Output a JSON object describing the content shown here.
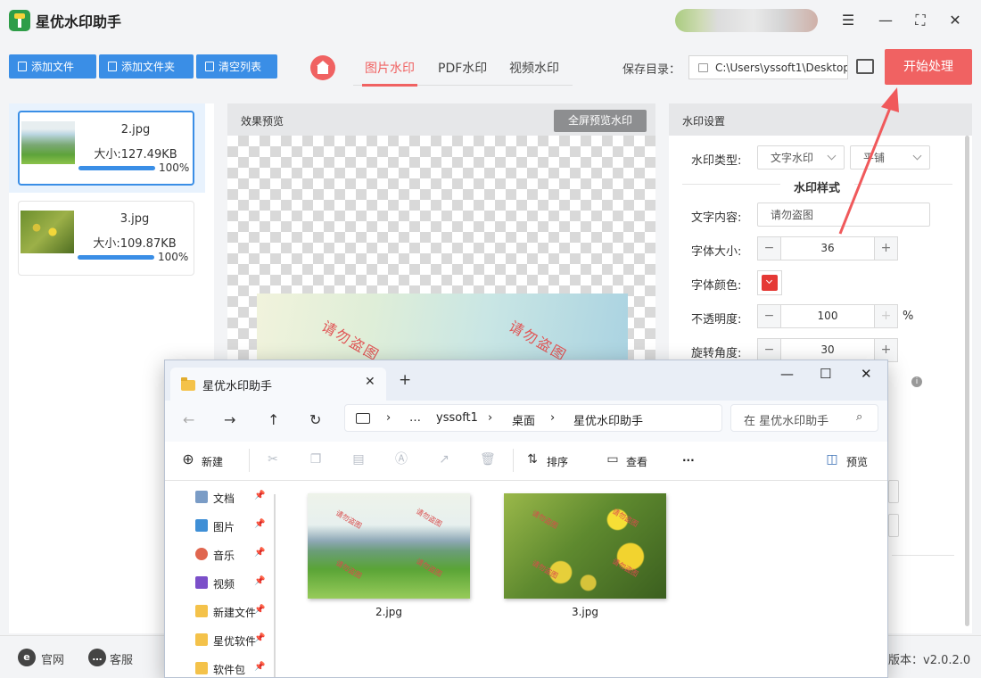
{
  "app": {
    "title": "星优水印助手",
    "colors": {
      "accent": "#3a8ee6",
      "brand_red": "#f06262"
    }
  },
  "toolbar": {
    "add_file": "添加文件",
    "add_folder": "添加文件夹",
    "clear_list": "清空列表"
  },
  "tabs": [
    "图片水印",
    "PDF水印",
    "视频水印"
  ],
  "save": {
    "label": "保存目录：",
    "path": "C:\\Users\\yssoft1\\Desktop"
  },
  "start_button": "开始处理",
  "files": [
    {
      "name": "2.jpg",
      "size": "大小:127.49KB",
      "progress": "100%"
    },
    {
      "name": "3.jpg",
      "size": "大小:109.87KB",
      "progress": "100%"
    }
  ],
  "preview": {
    "title": "效果预览",
    "fullscreen_button": "全屏预览水印",
    "watermark_text": "请勿盗图"
  },
  "settings": {
    "title": "水印设置",
    "type_label": "水印类型:",
    "type_value": "文字水印",
    "layout_value": "平铺",
    "style_title": "水印样式",
    "text_label": "文字内容:",
    "text_value": "请勿盗图",
    "font_size_label": "字体大小:",
    "font_size_value": "36",
    "color_label": "字体颜色:",
    "color_value": "#e53935",
    "opacity_label": "不透明度:",
    "opacity_value": "100",
    "opacity_unit": "%",
    "rotation_label": "旋转角度:",
    "rotation_value": "30",
    "stepper_minus": "−",
    "stepper_plus": "+"
  },
  "statusbar": {
    "website": "官网",
    "support": "客服",
    "version": "版本：v2.0.2.0"
  },
  "explorer": {
    "tab_title": "星优水印助手",
    "breadcrumb": [
      "…",
      "yssoft1",
      "桌面",
      "星优水印助手"
    ],
    "search_placeholder": "在 星优水印助手",
    "commands": {
      "new": "新建",
      "sort": "排序",
      "view": "查看",
      "more": "···",
      "preview": "预览"
    },
    "sidebar": [
      {
        "label": "文档",
        "icon": "document-icon"
      },
      {
        "label": "图片",
        "icon": "pictures-icon"
      },
      {
        "label": "音乐",
        "icon": "music-icon"
      },
      {
        "label": "视频",
        "icon": "video-icon"
      },
      {
        "label": "新建文件",
        "icon": "folder-icon"
      },
      {
        "label": "星优软件",
        "icon": "folder-icon"
      },
      {
        "label": "软件包",
        "icon": "folder-icon"
      }
    ],
    "files": [
      {
        "name": "2.jpg"
      },
      {
        "name": "3.jpg"
      }
    ]
  }
}
